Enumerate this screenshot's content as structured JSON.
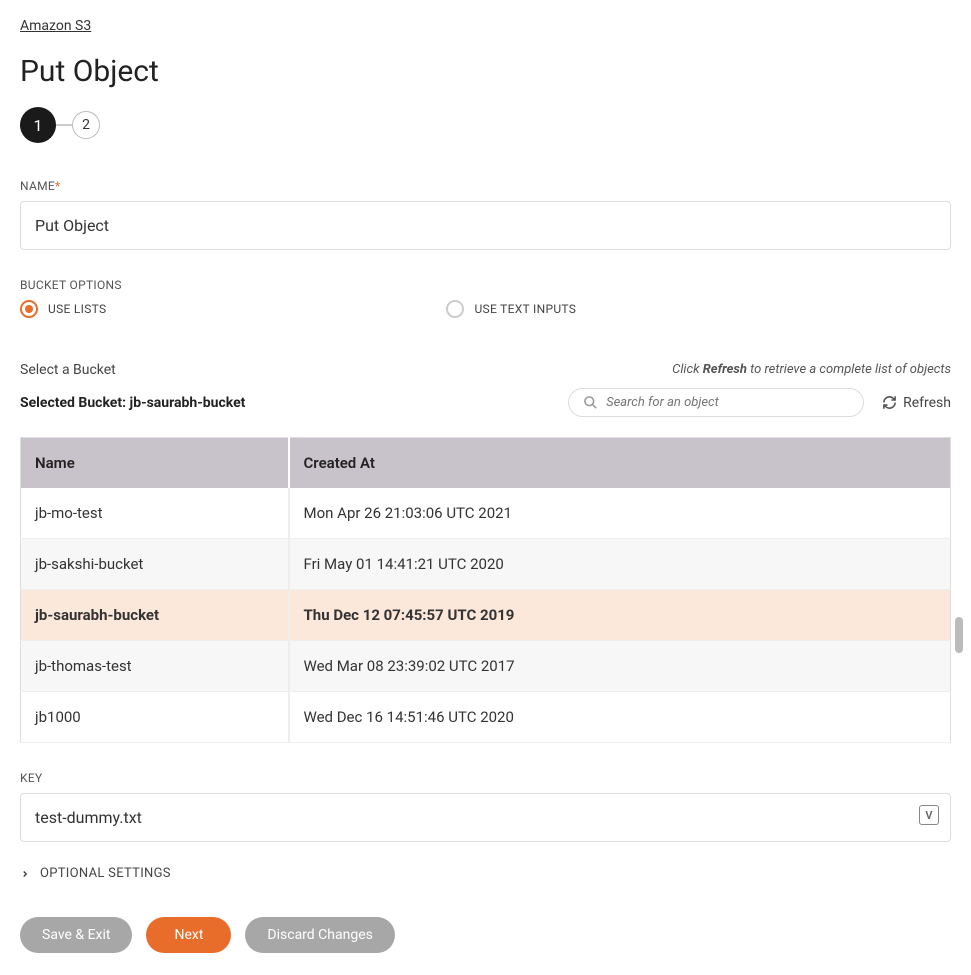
{
  "breadcrumb": "Amazon S3",
  "pageTitle": "Put Object",
  "stepper": {
    "current": "1",
    "next": "2"
  },
  "nameField": {
    "label": "NAME",
    "value": "Put Object"
  },
  "bucketOptions": {
    "label": "BUCKET OPTIONS",
    "useLists": "USE LISTS",
    "useTextInputs": "USE TEXT INPUTS",
    "selected": "useLists"
  },
  "bucketSection": {
    "selectLabel": "Select a Bucket",
    "hintPrefix": "Click ",
    "hintBold": "Refresh",
    "hintSuffix": " to retrieve a complete list of objects",
    "selectedLabel": "Selected Bucket: ",
    "selectedValue": "jb-saurabh-bucket",
    "searchPlaceholder": "Search for an object",
    "refreshLabel": "Refresh"
  },
  "table": {
    "headers": {
      "name": "Name",
      "createdAt": "Created At"
    },
    "rows": [
      {
        "name": "jb-mo-test",
        "createdAt": "Mon Apr 26 21:03:06 UTC 2021",
        "selected": false
      },
      {
        "name": "jb-sakshi-bucket",
        "createdAt": "Fri May 01 14:41:21 UTC 2020",
        "selected": false
      },
      {
        "name": "jb-saurabh-bucket",
        "createdAt": "Thu Dec 12 07:45:57 UTC 2019",
        "selected": true
      },
      {
        "name": "jb-thomas-test",
        "createdAt": "Wed Mar 08 23:39:02 UTC 2017",
        "selected": false
      },
      {
        "name": "jb1000",
        "createdAt": "Wed Dec 16 14:51:46 UTC 2020",
        "selected": false
      }
    ]
  },
  "keyField": {
    "label": "KEY",
    "value": "test-dummy.txt",
    "badge": "V"
  },
  "optionalSettings": {
    "label": "OPTIONAL SETTINGS"
  },
  "buttons": {
    "saveExit": "Save & Exit",
    "next": "Next",
    "discard": "Discard Changes"
  },
  "colors": {
    "accent": "#e86c2a"
  }
}
